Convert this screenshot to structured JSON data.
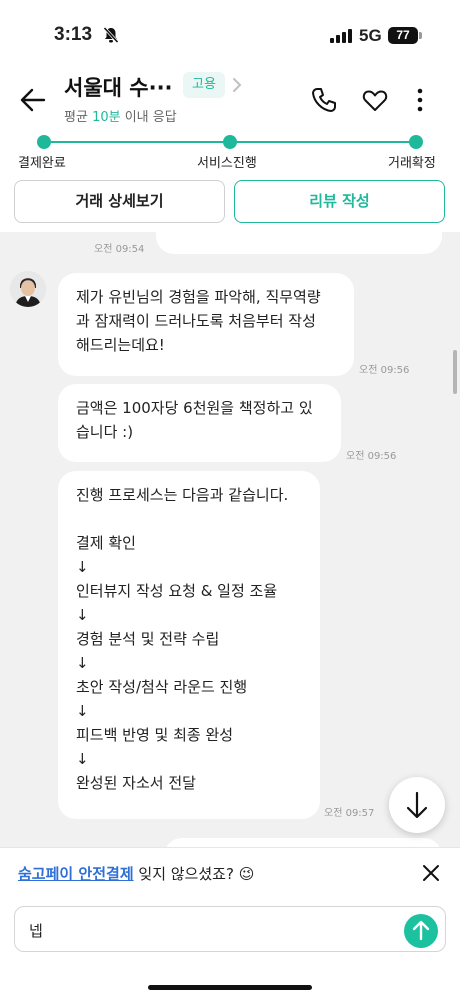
{
  "status_bar": {
    "time": "3:13",
    "network": "5G",
    "battery": "77"
  },
  "header": {
    "title": "서울대 수···",
    "badge": "고용",
    "subtitle_prefix": "평균 ",
    "subtitle_highlight": "10분",
    "subtitle_suffix": " 이내 응답"
  },
  "progress": {
    "steps": [
      "결제완료",
      "서비스진행",
      "거래확정"
    ]
  },
  "actions": {
    "detail_label": "거래 상세보기",
    "review_label": "리뷰 작성"
  },
  "messages": [
    {
      "text": "",
      "time": "오전 09:54",
      "partial": true
    },
    {
      "text": "제가 유빈님의 경험을 파악해, 직무역량\n과 잠재력이 드러나도록 처음부터 작성\n해드리는데요!",
      "time": "오전 09:56"
    },
    {
      "text": "금액은 100자당 6천원을 책정하고 있\n습니다 :)",
      "time": "오전 09:56"
    },
    {
      "text": "진행 프로세스는 다음과 같습니다.\n\n결제 확인\n↓\n인터뷰지 작성 요청 & 일정 조율\n↓\n경험 분석 및 전략 수립\n↓\n초안 작성/첨삭 라운드 진행\n↓\n피드백 반영 및 최종 완성\n↓\n완성된 자소서 전달",
      "time": "오전 09:57"
    }
  ],
  "banner": {
    "link_text": "숨고페이 안전결제",
    "text": " 잊지 않으셨죠? 😉"
  },
  "input": {
    "value": "넵",
    "placeholder": ""
  },
  "colors": {
    "accent": "#20b89a",
    "link": "#2f6fd6",
    "chat_bg": "#f1f1f1"
  }
}
